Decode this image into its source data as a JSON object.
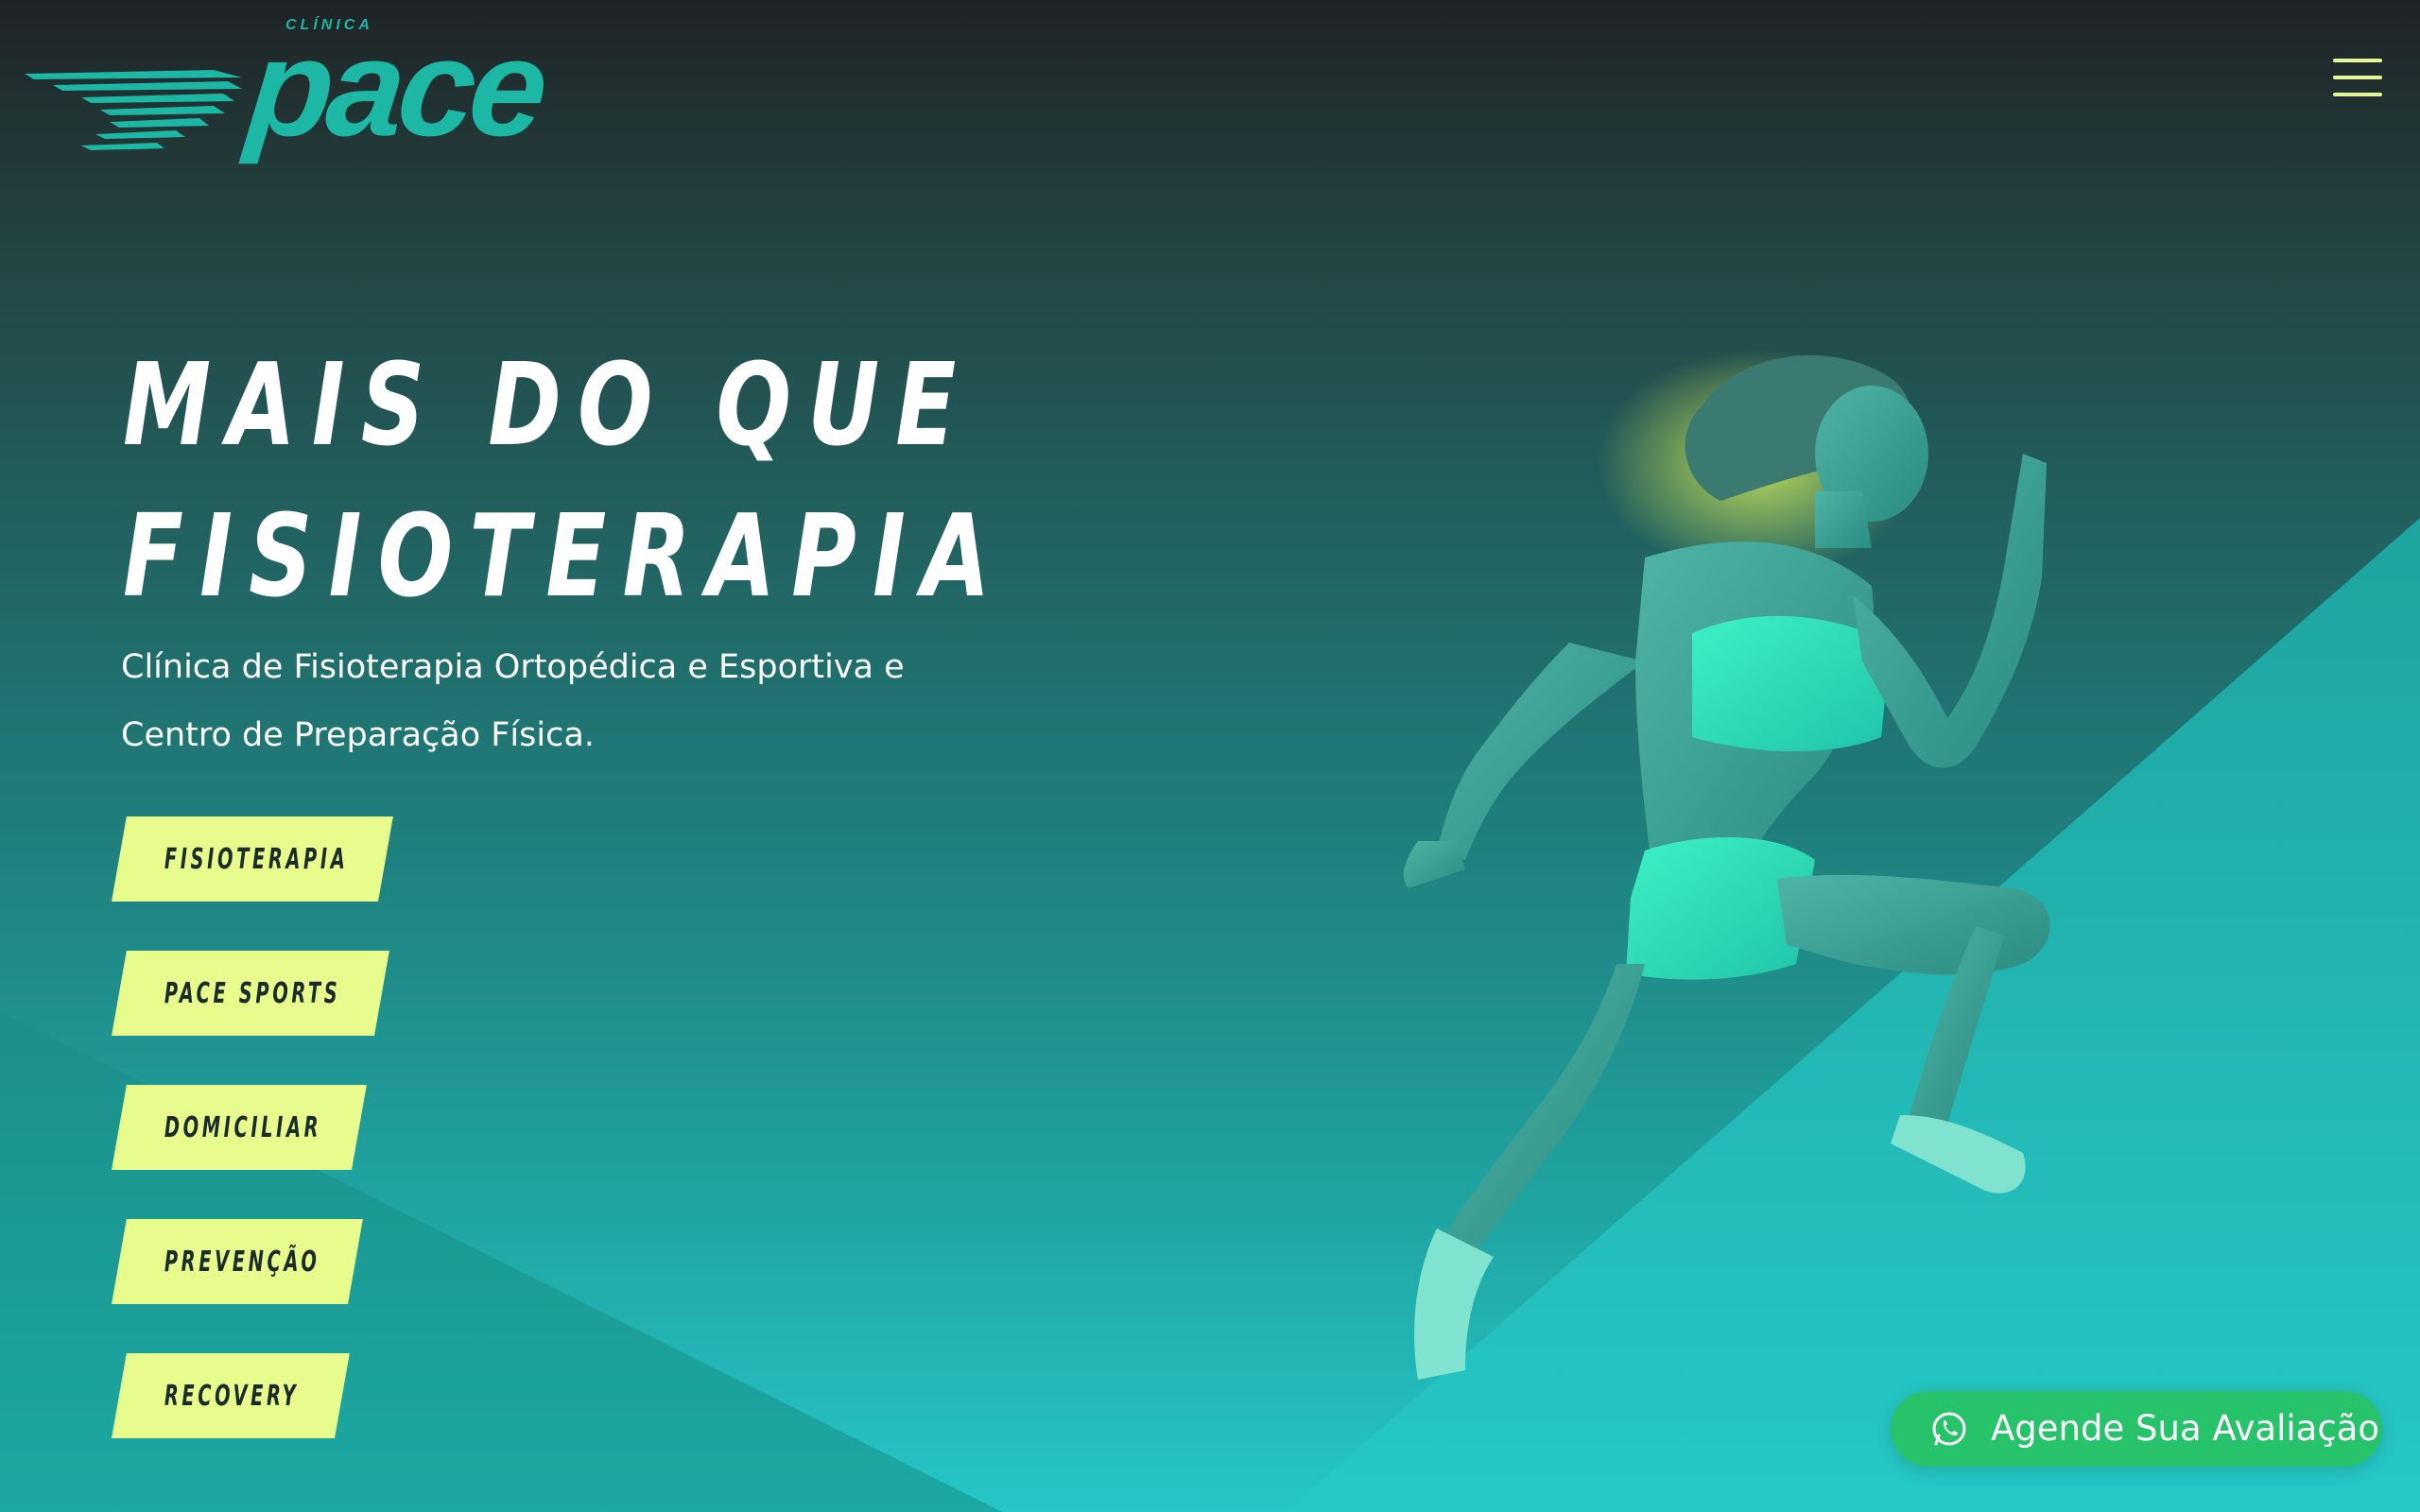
{
  "brand": {
    "small_label": "CLÍNICA",
    "name": "pace",
    "color": "#1cb8a5"
  },
  "header": {
    "menu_icon": "hamburger-menu-icon"
  },
  "hero": {
    "title_line1": "MAIS DO QUE",
    "title_line2": "FISIOTERAPIA",
    "subtitle_line1": "Clínica de Fisioterapia Ortopédica e Esportiva e",
    "subtitle_line2": "Centro de Preparação Física."
  },
  "services": [
    {
      "label": "FISIOTERAPIA"
    },
    {
      "label": "PACE SPORTS"
    },
    {
      "label": "DOMICILIAR"
    },
    {
      "label": "PREVENÇÃO"
    },
    {
      "label": "RECOVERY"
    }
  ],
  "cta": {
    "label": "Agende Sua Avaliação",
    "icon": "whatsapp-icon",
    "color": "#27c36b"
  },
  "colors": {
    "accent": "#e8fb8d",
    "teal": "#26c6c6",
    "dark": "#1f2325"
  }
}
